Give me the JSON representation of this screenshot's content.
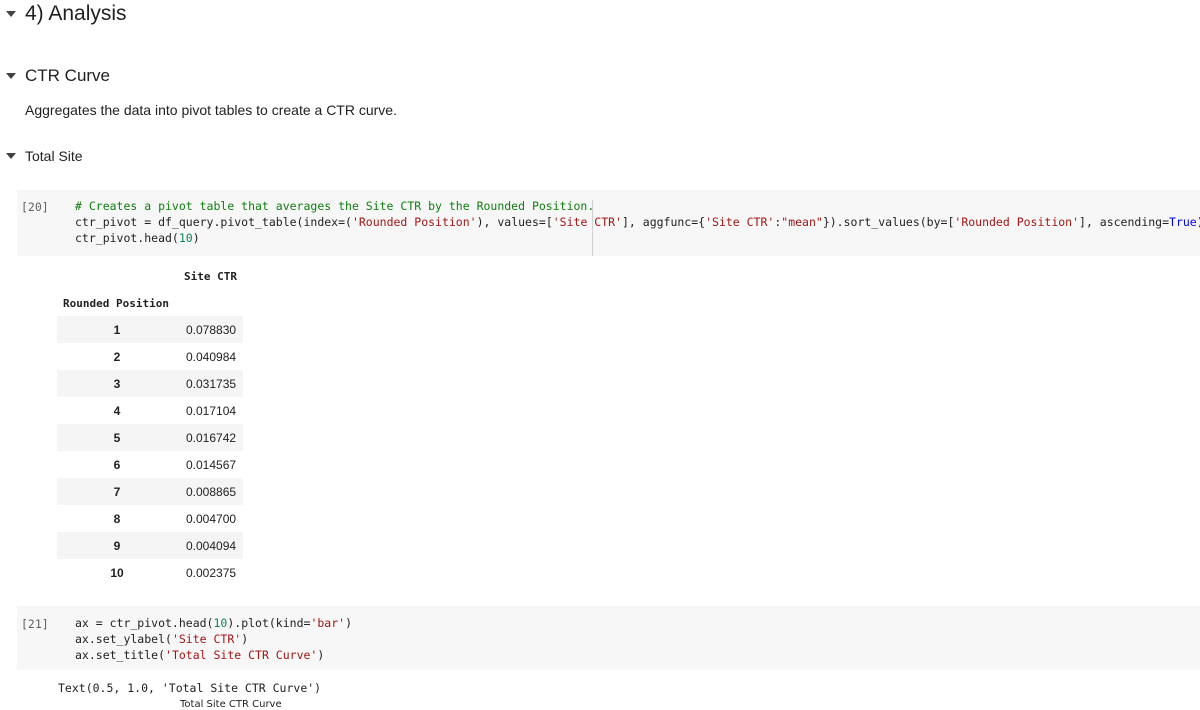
{
  "sections": {
    "analysis": "4) Analysis",
    "ctr_curve": "CTR Curve",
    "ctr_curve_desc": "Aggregates the data into pivot tables to create a CTR curve.",
    "total_site": "Total Site"
  },
  "cell20": {
    "prompt": "[20]",
    "line1": "# Creates a pivot table that averages the Site CTR by the Rounded Position.",
    "line2": {
      "a": "ctr_pivot = df_query.pivot_table(index=(",
      "s1": "'Rounded Position'",
      "b": "), values=[",
      "s2": "'Site CTR'",
      "c": "], aggfunc={",
      "s3": "'Site CTR'",
      "d": ":",
      "s4": "\"mean\"",
      "e": "}).sort_values(by=[",
      "s5": "'Rounded Position'",
      "f": "], ascending=",
      "kw": "True",
      "g": ")"
    },
    "line3": {
      "a": "ctr_pivot.head(",
      "n": "10",
      "b": ")"
    }
  },
  "output_table": {
    "column_header": "Site CTR",
    "index_name": "Rounded Position",
    "rows": [
      {
        "idx": "1",
        "val": "0.078830"
      },
      {
        "idx": "2",
        "val": "0.040984"
      },
      {
        "idx": "3",
        "val": "0.031735"
      },
      {
        "idx": "4",
        "val": "0.017104"
      },
      {
        "idx": "5",
        "val": "0.016742"
      },
      {
        "idx": "6",
        "val": "0.014567"
      },
      {
        "idx": "7",
        "val": "0.008865"
      },
      {
        "idx": "8",
        "val": "0.004700"
      },
      {
        "idx": "9",
        "val": "0.004094"
      },
      {
        "idx": "10",
        "val": "0.002375"
      }
    ]
  },
  "cell21": {
    "prompt": "[21]",
    "line1": {
      "a": "ax = ctr_pivot.head(",
      "n": "10",
      "b": ").plot(kind=",
      "s": "'bar'",
      "c": ")"
    },
    "line2": {
      "a": "ax.set_ylabel(",
      "s": "'Site CTR'",
      "b": ")"
    },
    "line3": {
      "a": "ax.set_title(",
      "s": "'Total Site CTR Curve'",
      "b": ")"
    }
  },
  "output_text": "Text(0.5, 1.0, 'Total Site CTR Curve')",
  "plot_title_clipped": "Total Site CTR Curve",
  "colors": {
    "comment": "#0d7f0d",
    "string": "#a31515",
    "number": "#098658",
    "keyword": "#0000ff",
    "cell_bg": "#f7f7f7"
  }
}
